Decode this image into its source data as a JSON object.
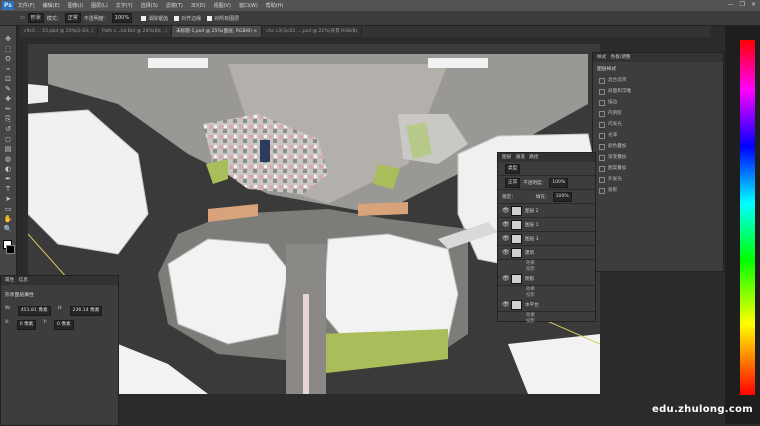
{
  "app": {
    "logo": "Ps"
  },
  "menu": [
    "文件(F)",
    "编辑(E)",
    "图像(I)",
    "图层(L)",
    "文字(Y)",
    "选择(S)",
    "滤镜(T)",
    "3D(D)",
    "视图(V)",
    "窗口(W)",
    "帮助(H)"
  ],
  "window_controls": [
    "—",
    "❐",
    "✕"
  ],
  "options_bar": {
    "select1": "形状",
    "mode_label": "模式：",
    "mode_value": "正常",
    "opacity_label": "不透明度：",
    "opacity_value": "100%",
    "antialias_label": "消除锯齿",
    "align_label": "对齐边缘",
    "other_label": "对所有图层"
  },
  "tabs": [
    {
      "label": "c9c0 ... 15.pbd @ 20%(2-Eit..)",
      "active": false
    },
    {
      "label": "Path c...nd.Bid @ 20%(Bit...)",
      "active": false
    },
    {
      "label": "未标题-1.psd @ 25%(图层, RGB/8) ×",
      "active": true
    },
    {
      "label": "chc c3(3ic01 ... psd @ 22%(背景 RGB/8)",
      "active": false
    }
  ],
  "toolbar_icons": [
    "move-icon",
    "marquee-icon",
    "lasso-icon",
    "quick-select-icon",
    "crop-icon",
    "eyedropper-icon",
    "healing-icon",
    "brush-icon",
    "stamp-icon",
    "history-brush-icon",
    "eraser-icon",
    "gradient-icon",
    "blur-icon",
    "dodge-icon",
    "pen-icon",
    "type-icon",
    "path-select-icon",
    "shape-icon",
    "hand-icon",
    "zoom-icon"
  ],
  "tool_glyphs": [
    "✥",
    "⬚",
    "ʘ",
    "⌁",
    "⊡",
    "✎",
    "✚",
    "✏",
    "⎘",
    "↺",
    "◻",
    "▤",
    "◍",
    "◐",
    "✒",
    "T",
    "➤",
    "▭",
    "✋",
    "🔍"
  ],
  "layers_panel": {
    "tabs": [
      "图层",
      "通道",
      "路径"
    ],
    "filter_label": "类型",
    "blend_mode": "正常",
    "opacity_label": "不透明度：",
    "opacity": "100%",
    "lock_label": "锁定：",
    "fill_label": "填充：",
    "fill": "100%",
    "layers": [
      {
        "name": "图层 2",
        "effects": []
      },
      {
        "name": "图层 1",
        "effects": []
      },
      {
        "name": "图层 3",
        "effects": []
      },
      {
        "name": "建筑",
        "effects": [
          "效果",
          "投影"
        ]
      },
      {
        "name": "阴影",
        "effects": [
          "效果",
          "投影"
        ]
      },
      {
        "name": "水平台",
        "effects": [
          "效果",
          "投影"
        ]
      }
    ]
  },
  "right_panel": {
    "tabs": [
      "样式",
      "色板/调整"
    ],
    "title": "图层样式",
    "options": [
      "混合选项",
      "斜面和浮雕",
      "描边",
      "内阴影",
      "内发光",
      "光泽",
      "颜色叠加",
      "渐变叠加",
      "图案叠加",
      "外发光",
      "投影"
    ]
  },
  "properties_panel": {
    "tabs": [
      "属性",
      "信息"
    ],
    "title": "形状图层属性",
    "w_label": "W:",
    "w_value": "451.81 像素",
    "h_label": "H:",
    "h_value": "236.14 像素",
    "x_label": "X:",
    "x_value": "0 像素",
    "y_label": "Y:",
    "y_value": "0 像素"
  },
  "watermark": "edu.zhulong.com"
}
